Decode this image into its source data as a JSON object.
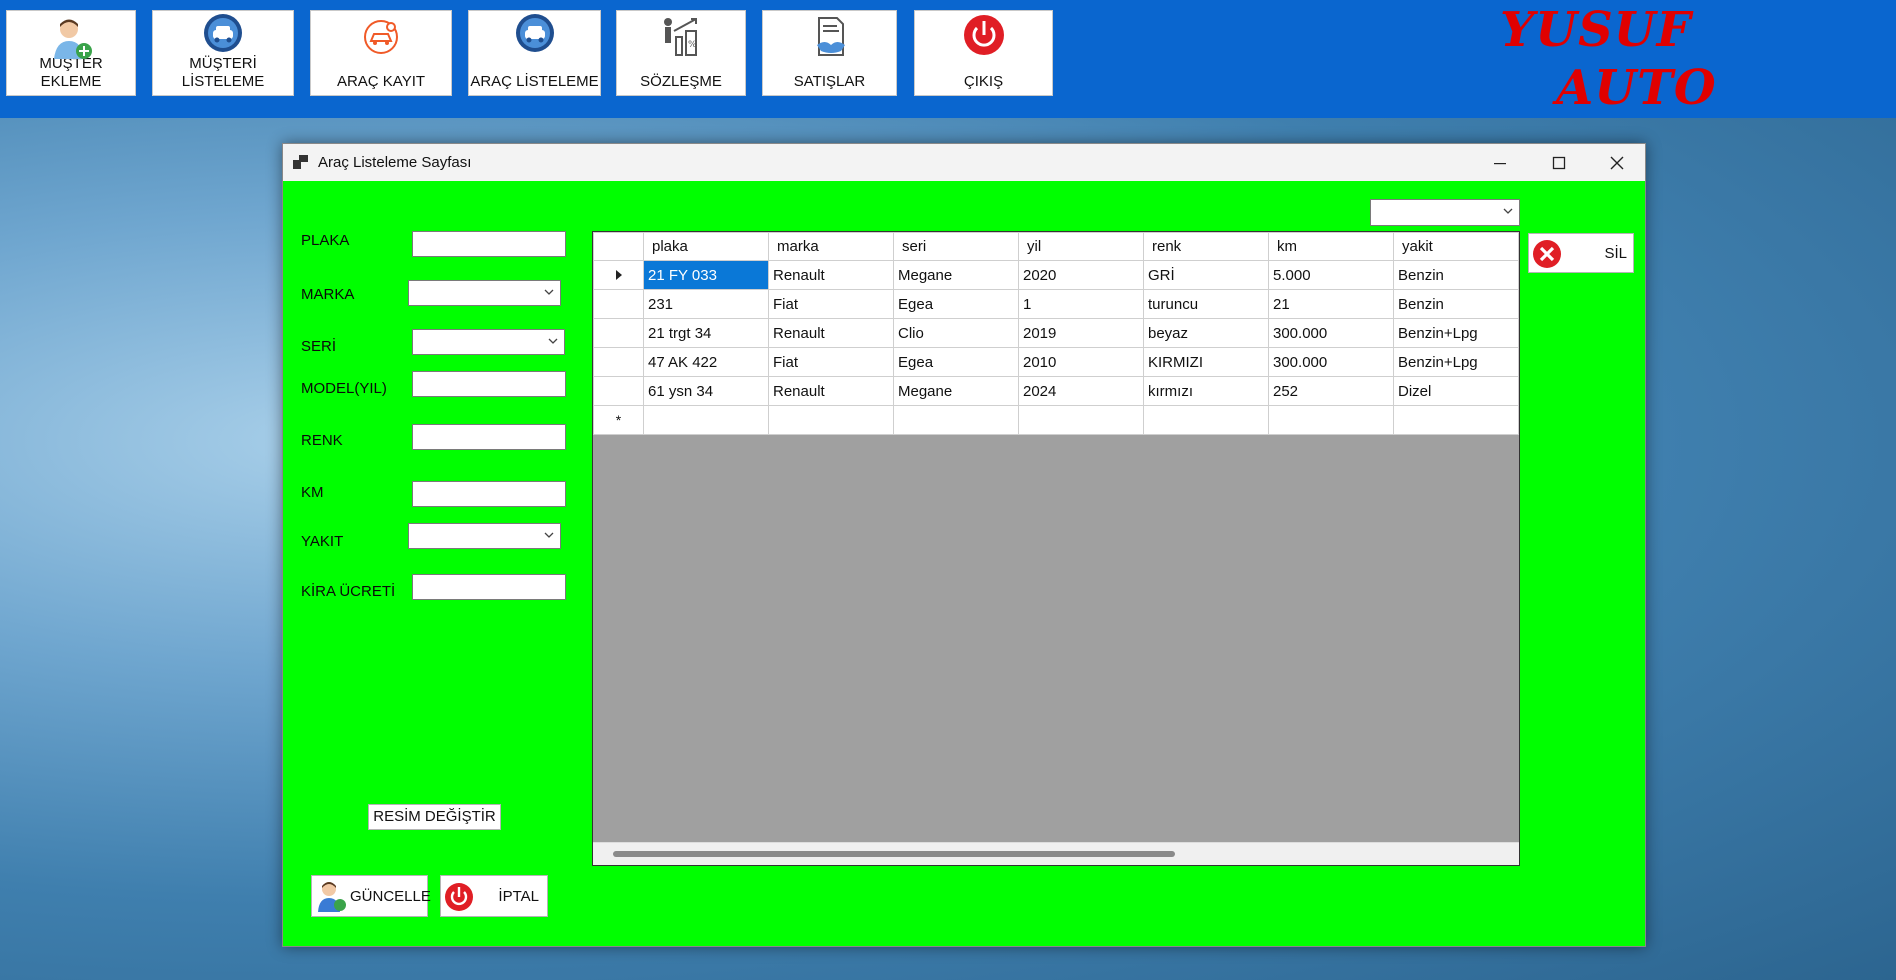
{
  "menu": {
    "musteri_ekleme": "MÜŞTER EKLEME",
    "musteri_listeleme_line1": "MÜŞTERİ",
    "musteri_listeleme_line2": "LİSTELEME",
    "arac_kayit": "ARAÇ KAYIT",
    "arac_listeleme": "ARAÇ LİSTELEME",
    "sozlesme": "SÖZLEŞME",
    "satislar": "SATIŞLAR",
    "cikis": "ÇIKIŞ"
  },
  "logo": {
    "line1": "YUSUF",
    "line2": "AUTO",
    "color": "#e00000"
  },
  "window": {
    "title": "Araç Listeleme Sayfası"
  },
  "form": {
    "plaka": "PLAKA",
    "marka": "MARKA",
    "seri": "SERİ",
    "model": "MODEL(YIL)",
    "renk": "RENK",
    "km": "KM",
    "yakit": "YAKIT",
    "kira": "KİRA ÜCRETİ",
    "resim_button": "RESİM DEĞİŞTİR",
    "guncelle_button": "GÜNCELLE",
    "iptal_button": "İPTAL"
  },
  "sil_button": "SİL",
  "grid": {
    "columns": [
      "plaka",
      "marka",
      "seri",
      "yil",
      "renk",
      "km",
      "yakit"
    ],
    "rows": [
      [
        "21 FY 033",
        "Renault",
        "Megane",
        "2020",
        "GRİ",
        "5.000",
        "Benzin"
      ],
      [
        "231",
        "Fiat",
        "Egea",
        "1",
        "turuncu",
        "21",
        "Benzin"
      ],
      [
        "21 trgt 34",
        "Renault",
        "Clio",
        "2019",
        "beyaz",
        "300.000",
        "Benzin+Lpg"
      ],
      [
        "47 AK 422",
        "Fiat",
        "Egea",
        "2010",
        "KIRMIZI",
        "300.000",
        "Benzin+Lpg"
      ],
      [
        "61 ysn 34",
        "Renault",
        "Megane",
        "2024",
        "kırmızı",
        "252",
        "Dizel"
      ]
    ],
    "new_row_marker": "*",
    "selected_color": "#0a78d7"
  },
  "colors": {
    "topbar": "#0a66cf",
    "form_bg": "#00ff00"
  }
}
